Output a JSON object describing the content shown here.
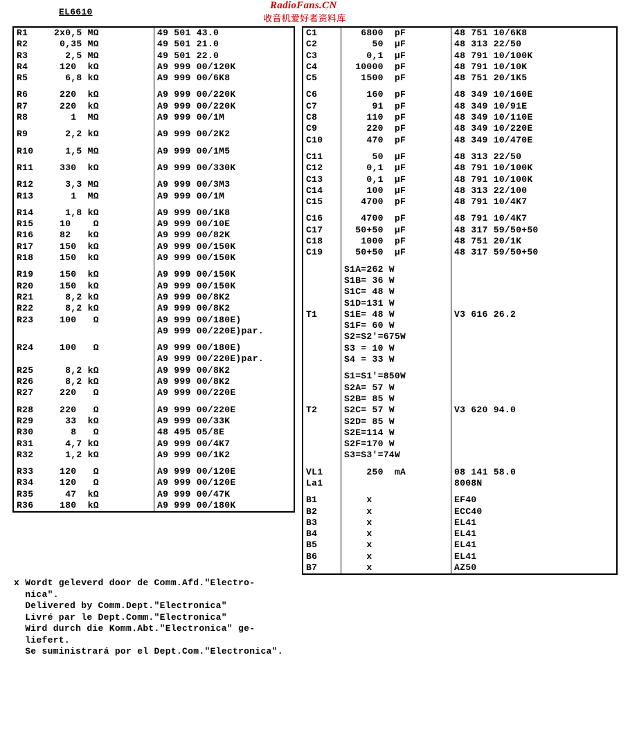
{
  "header": {
    "model": "EL6610",
    "watermark1": "RadioFans.CN",
    "watermark2": "收音机爱好者资料库"
  },
  "left": {
    "groups": [
      [
        {
          "ref": "R1",
          "val": "2x0,5 MΩ",
          "code": "49 501 43.0"
        },
        {
          "ref": "R2",
          "val": " 0,35 MΩ",
          "code": "49 501 21.0"
        },
        {
          "ref": "R3",
          "val": "  2,5 MΩ",
          "code": "49 501 22.0"
        },
        {
          "ref": "R4",
          "val": " 120  kΩ",
          "code": "A9 999 00/120K"
        },
        {
          "ref": "R5",
          "val": "  6,8 kΩ",
          "code": "A9 999 00/6K8"
        }
      ],
      [
        {
          "ref": "R6",
          "val": " 220  kΩ",
          "code": "A9 999 00/220K"
        },
        {
          "ref": "R7",
          "val": " 220  kΩ",
          "code": "A9 999 00/220K"
        },
        {
          "ref": "R8",
          "val": "   1  MΩ",
          "code": "A9 999 00/1M"
        }
      ],
      [
        {
          "ref": "R9",
          "val": "  2,2 kΩ",
          "code": "A9 999 00/2K2"
        }
      ],
      [
        {
          "ref": "R10",
          "val": "  1,5 MΩ",
          "code": "A9 999 00/1M5"
        }
      ],
      [
        {
          "ref": "R11",
          "val": " 330  kΩ",
          "code": "A9 999 00/330K"
        }
      ],
      [
        {
          "ref": "R12",
          "val": "  3,3 MΩ",
          "code": "A9 999 00/3M3"
        },
        {
          "ref": "R13",
          "val": "   1  MΩ",
          "code": "A9 999 00/1M"
        }
      ],
      [
        {
          "ref": "R14",
          "val": "  1,8 kΩ",
          "code": "A9 999 00/1K8"
        },
        {
          "ref": "R15",
          "val": " 10    Ω",
          "code": "A9 999 00/10E"
        },
        {
          "ref": "R16",
          "val": " 82   kΩ",
          "code": "A9 999 00/82K"
        },
        {
          "ref": "R17",
          "val": " 150  kΩ",
          "code": "A9 999 00/150K"
        },
        {
          "ref": "R18",
          "val": " 150  kΩ",
          "code": "A9 999 00/150K"
        }
      ],
      [
        {
          "ref": "R19",
          "val": " 150  kΩ",
          "code": "A9 999 00/150K"
        },
        {
          "ref": "R20",
          "val": " 150  kΩ",
          "code": "A9 999 00/150K"
        },
        {
          "ref": "R21",
          "val": "  8,2 kΩ",
          "code": "A9 999 00/8K2"
        },
        {
          "ref": "R22",
          "val": "  8,2 kΩ",
          "code": "A9 999 00/8K2"
        },
        {
          "ref": "R23",
          "val": " 100   Ω",
          "code": "A9 999 00/180E)\nA9 999 00/220E)par."
        }
      ],
      [
        {
          "ref": "R24",
          "val": " 100   Ω",
          "code": "A9 999 00/180E)\nA9 999 00/220E)par."
        },
        {
          "ref": "R25",
          "val": "  8,2 kΩ",
          "code": "A9 999 00/8K2"
        },
        {
          "ref": "R26",
          "val": "  8,2 kΩ",
          "code": "A9 999 00/8K2"
        },
        {
          "ref": "R27",
          "val": " 220   Ω",
          "code": "A9 999 00/220E"
        }
      ],
      [
        {
          "ref": "R28",
          "val": " 220   Ω",
          "code": "A9 999 00/220E"
        },
        {
          "ref": "R29",
          "val": "  33  kΩ",
          "code": "A9 999 00/33K"
        },
        {
          "ref": "R30",
          "val": "   8   Ω",
          "code": "48 495 05/8E"
        },
        {
          "ref": "R31",
          "val": "  4,7 kΩ",
          "code": "A9 999 00/4K7"
        },
        {
          "ref": "R32",
          "val": "  1,2 kΩ",
          "code": "A9 999 00/1K2"
        }
      ],
      [
        {
          "ref": "R33",
          "val": " 120   Ω",
          "code": "A9 999 00/120E"
        },
        {
          "ref": "R34",
          "val": " 120   Ω",
          "code": "A9 999 00/120E"
        },
        {
          "ref": "R35",
          "val": "  47  kΩ",
          "code": "A9 999 00/47K"
        },
        {
          "ref": "R36",
          "val": " 180  kΩ",
          "code": "A9 999 00/180K"
        }
      ]
    ]
  },
  "right": {
    "groups": [
      [
        {
          "ref": "C1",
          "val": "   6800  pF",
          "code": "48 751 10/6K8"
        },
        {
          "ref": "C2",
          "val": "     50  µF",
          "code": "48 313 22/50"
        },
        {
          "ref": "C3",
          "val": "    0,1  µF",
          "code": "48 791 10/100K"
        },
        {
          "ref": "C4",
          "val": "  10000  pF",
          "code": "48 791 10/10K"
        },
        {
          "ref": "C5",
          "val": "   1500  pF",
          "code": "48 751 20/1K5"
        }
      ],
      [
        {
          "ref": "C6",
          "val": "    160  pF",
          "code": "48 349 10/160E"
        },
        {
          "ref": "C7",
          "val": "     91  pF",
          "code": "48 349 10/91E"
        },
        {
          "ref": "C8",
          "val": "    110  pF",
          "code": "48 349 10/110E"
        },
        {
          "ref": "C9",
          "val": "    220  pF",
          "code": "48 349 10/220E"
        },
        {
          "ref": "C10",
          "val": "    470  pF",
          "code": "48 349 10/470E"
        }
      ],
      [
        {
          "ref": "C11",
          "val": "     50  µF",
          "code": "48 313 22/50"
        },
        {
          "ref": "C12",
          "val": "    0,1  µF",
          "code": "48 791 10/100K"
        },
        {
          "ref": "C13",
          "val": "    0,1  µF",
          "code": "48 791 10/100K"
        },
        {
          "ref": "C14",
          "val": "    100  µF",
          "code": "48 313 22/100"
        },
        {
          "ref": "C15",
          "val": "   4700  pF",
          "code": "48 791 10/4K7"
        }
      ],
      [
        {
          "ref": "C16",
          "val": "   4700  pF",
          "code": "48 791 10/4K7"
        },
        {
          "ref": "C17",
          "val": "  50+50  µF",
          "code": "48 317 59/50+50"
        },
        {
          "ref": "C18",
          "val": "   1000  pF",
          "code": "48 751 20/1K"
        },
        {
          "ref": "C19",
          "val": "  50+50  µF",
          "code": "48 317 59/50+50"
        }
      ],
      [
        {
          "ref": "",
          "val": "S1A=262 W",
          "code": ""
        },
        {
          "ref": "",
          "val": "S1B= 36 W",
          "code": ""
        },
        {
          "ref": "",
          "val": "S1C= 48 W",
          "code": ""
        },
        {
          "ref": "",
          "val": "S1D=131 W",
          "code": ""
        },
        {
          "ref": "T1",
          "val": "S1E= 48 W",
          "code": "V3 616 26.2"
        },
        {
          "ref": "",
          "val": "S1F= 60 W",
          "code": ""
        },
        {
          "ref": "",
          "val": "S2=S2'=675W",
          "code": ""
        },
        {
          "ref": "",
          "val": "S3 = 10 W",
          "code": ""
        },
        {
          "ref": "",
          "val": "S4 = 33 W",
          "code": ""
        }
      ],
      [
        {
          "ref": "",
          "val": "S1=S1'=850W",
          "code": ""
        },
        {
          "ref": "",
          "val": "S2A= 57 W",
          "code": ""
        },
        {
          "ref": "",
          "val": "S2B= 85 W",
          "code": ""
        },
        {
          "ref": "T2",
          "val": "S2C= 57 W",
          "code": "V3 620 94.0"
        },
        {
          "ref": "",
          "val": "S2D= 85 W",
          "code": ""
        },
        {
          "ref": "",
          "val": "S2E=114 W",
          "code": ""
        },
        {
          "ref": "",
          "val": "S2F=170 W",
          "code": ""
        },
        {
          "ref": "",
          "val": "S3=S3'=74W",
          "code": ""
        }
      ],
      [
        {
          "ref": "VL1",
          "val": "    250  mA",
          "code": "08 141 58.0"
        },
        {
          "ref": "La1",
          "val": "",
          "code": "8008N"
        }
      ],
      [
        {
          "ref": "B1",
          "val": "    x",
          "code": "EF40"
        },
        {
          "ref": "B2",
          "val": "    x",
          "code": "ECC40"
        },
        {
          "ref": "B3",
          "val": "    x",
          "code": "EL41"
        },
        {
          "ref": "B4",
          "val": "    x",
          "code": "EL41"
        },
        {
          "ref": "B5",
          "val": "    x",
          "code": "EL41"
        },
        {
          "ref": "B6",
          "val": "    x",
          "code": "EL41"
        },
        {
          "ref": "B7",
          "val": "    x",
          "code": "AZ50"
        }
      ]
    ]
  },
  "footnote": "x Wordt geleverd door de Comm.Afd.\"Electro-\n  nica\".\n  Delivered by Comm.Dept.\"Electronica\"\n  Livré par le Dept.Comm.\"Electronica\"\n  Wird durch die Komm.Abt.\"Electronica\" ge-\n  liefert.\n  Se suministrará por el Dept.Com.\"Electronica\"."
}
